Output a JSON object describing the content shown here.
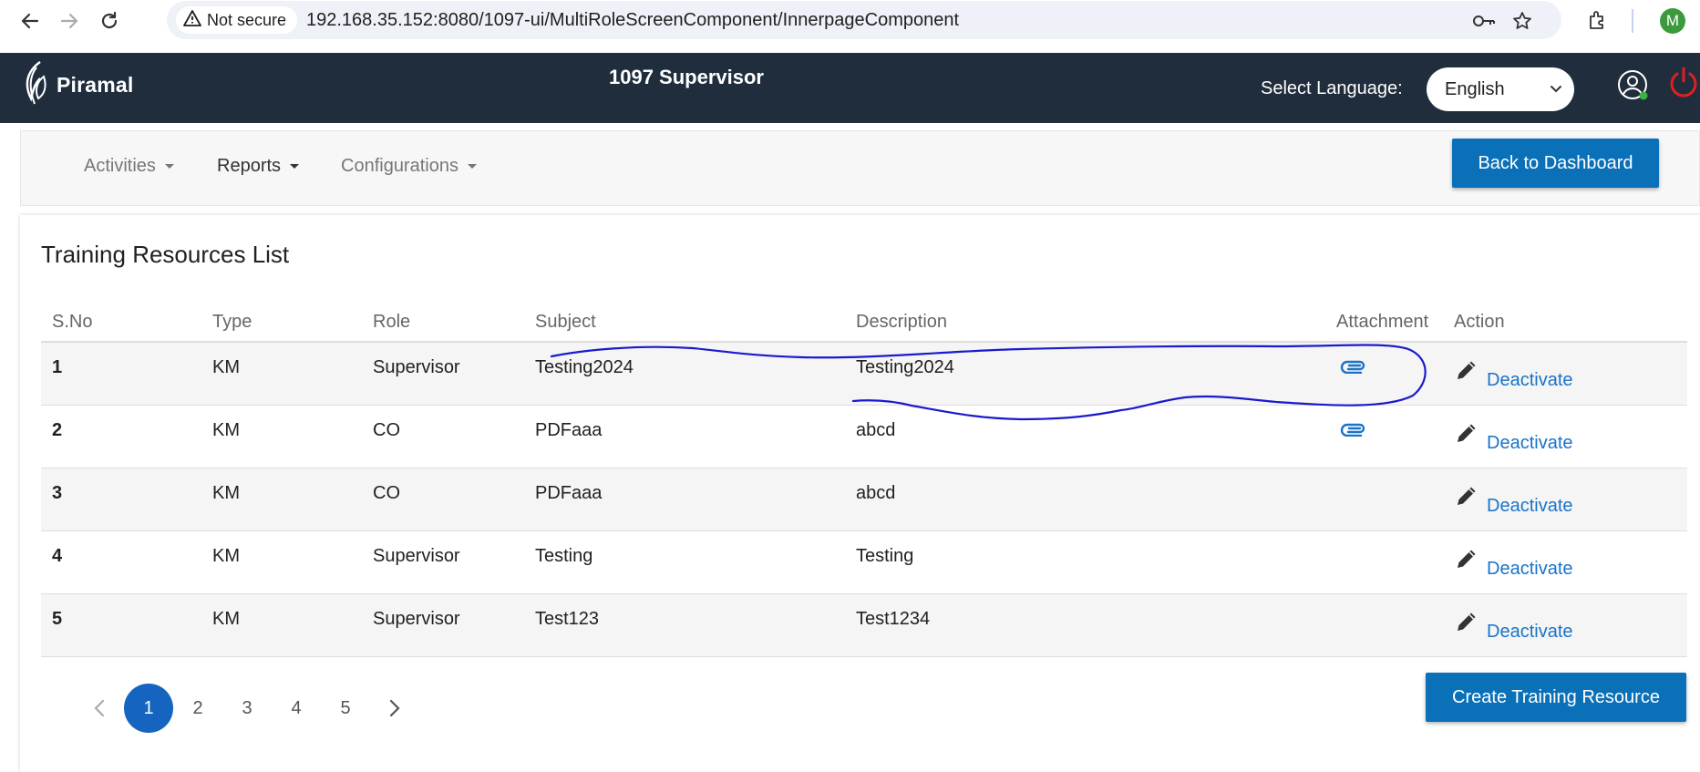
{
  "browser": {
    "security_label": "Not secure",
    "url": "192.168.35.152:8080/1097-ui/MultiRoleScreenComponent/InnerpageComponent",
    "profile_initial": "M"
  },
  "header": {
    "brand": "Piramal",
    "title": "1097 Supervisor",
    "language_label": "Select Language:",
    "language_value": "English"
  },
  "nav": {
    "menus": [
      {
        "label": "Activities"
      },
      {
        "label": "Reports"
      },
      {
        "label": "Configurations"
      }
    ],
    "back_button": "Back to Dashboard"
  },
  "page": {
    "title": "Training Resources List",
    "columns": [
      "S.No",
      "Type",
      "Role",
      "Subject",
      "Description",
      "Attachment",
      "Action"
    ],
    "rows": [
      {
        "sno": "1",
        "type": "KM",
        "role": "Supervisor",
        "subject": "Testing2024",
        "description": "Testing2024",
        "has_attachment": true,
        "action": "Deactivate"
      },
      {
        "sno": "2",
        "type": "KM",
        "role": "CO",
        "subject": "PDFaaa",
        "description": "abcd",
        "has_attachment": true,
        "action": "Deactivate"
      },
      {
        "sno": "3",
        "type": "KM",
        "role": "CO",
        "subject": "PDFaaa",
        "description": "abcd",
        "has_attachment": false,
        "action": "Deactivate"
      },
      {
        "sno": "4",
        "type": "KM",
        "role": "Supervisor",
        "subject": "Testing",
        "description": "Testing",
        "has_attachment": false,
        "action": "Deactivate"
      },
      {
        "sno": "5",
        "type": "KM",
        "role": "Supervisor",
        "subject": "Test123",
        "description": "Test1234",
        "has_attachment": false,
        "action": "Deactivate"
      }
    ],
    "pagination": {
      "pages": [
        "1",
        "2",
        "3",
        "4",
        "5"
      ],
      "current": "1"
    },
    "create_button": "Create Training Resource"
  },
  "colors": {
    "header_bg": "#1f2d3d",
    "primary_button": "#0a70b8",
    "link": "#1a73c9",
    "active_page": "#1565c0",
    "annotation": "#1a1acd"
  }
}
